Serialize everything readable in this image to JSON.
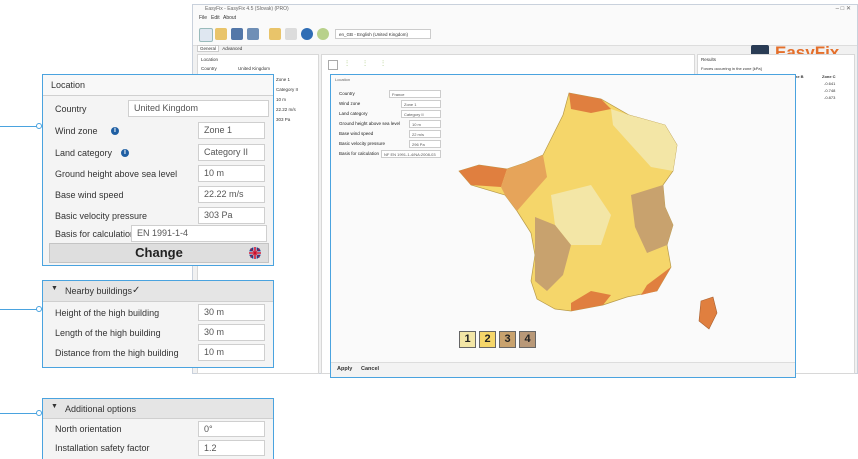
{
  "app": {
    "title": "EasyFix - EasyFix 4.5 (Slovak) (PRO)",
    "menu": [
      "File",
      "Edit",
      "About"
    ],
    "language": "en_GB - English (United Kingdom)",
    "brand": "EasyFix",
    "tabs": [
      "General",
      "Advanced"
    ],
    "left_panel": {
      "header": "Location",
      "country_label": "Country",
      "country_value": "United Kingdom",
      "values": [
        "Zone 1",
        "Category II",
        "10 m",
        "22.22 m/s",
        "303 Pa"
      ]
    },
    "results": {
      "tab": "Results",
      "section": "Forces occurring in the zone [kPa]",
      "columns": [
        "Height",
        "Zone A",
        "Zone B",
        "Zone C"
      ],
      "values": [
        "-0.641",
        "-0.748",
        "-0.873"
      ]
    }
  },
  "dialog": {
    "title": "Location",
    "rows": [
      {
        "label": "Country",
        "value": "France"
      },
      {
        "label": "Wind zone",
        "value": "Zone 1"
      },
      {
        "label": "Land category",
        "value": "Category II"
      },
      {
        "label": "Ground height above sea level",
        "value": "10 m"
      },
      {
        "label": "Base wind speed",
        "value": "22 m/s"
      },
      {
        "label": "Basic velocity pressure",
        "value": "296 Pa"
      },
      {
        "label": "Basis for calculation",
        "value": "NF EN 1991-1-4/NA:2008-03"
      }
    ],
    "zones": [
      "1",
      "2",
      "3",
      "4"
    ],
    "apply": "Apply",
    "cancel": "Cancel"
  },
  "location_card": {
    "title": "Location",
    "country_label": "Country",
    "country_value": "United Kingdom",
    "wind_zone_label": "Wind zone",
    "wind_zone_value": "Zone 1",
    "land_category_label": "Land category",
    "land_category_value": "Category II",
    "ground_height_label": "Ground height above sea level",
    "ground_height_value": "10 m",
    "base_wind_label": "Base wind speed",
    "base_wind_value": "22.22 m/s",
    "pressure_label": "Basic velocity pressure",
    "pressure_value": "303 Pa",
    "basis_label": "Basis for calculation",
    "basis_value": "EN 1991-1-4",
    "change_label": "Change"
  },
  "nearby_card": {
    "title": "Nearby buildings",
    "check": "✓",
    "rows": [
      {
        "label": "Height of the high building",
        "value": "30 m"
      },
      {
        "label": "Length of the high building",
        "value": "30 m"
      },
      {
        "label": "Distance from the high building",
        "value": "10 m"
      }
    ]
  },
  "options_card": {
    "title": "Additional options",
    "rows": [
      {
        "label": "North orientation",
        "value": "0°"
      },
      {
        "label": "Installation safety factor",
        "value": "1.2"
      }
    ]
  },
  "colors": {
    "accent": "#4aa3df",
    "brand": "#e46f2b",
    "zone1": "#f3e6a6",
    "zone2": "#f5d66a",
    "zone3": "#c8a26e",
    "zone4": "#e07f3f"
  }
}
